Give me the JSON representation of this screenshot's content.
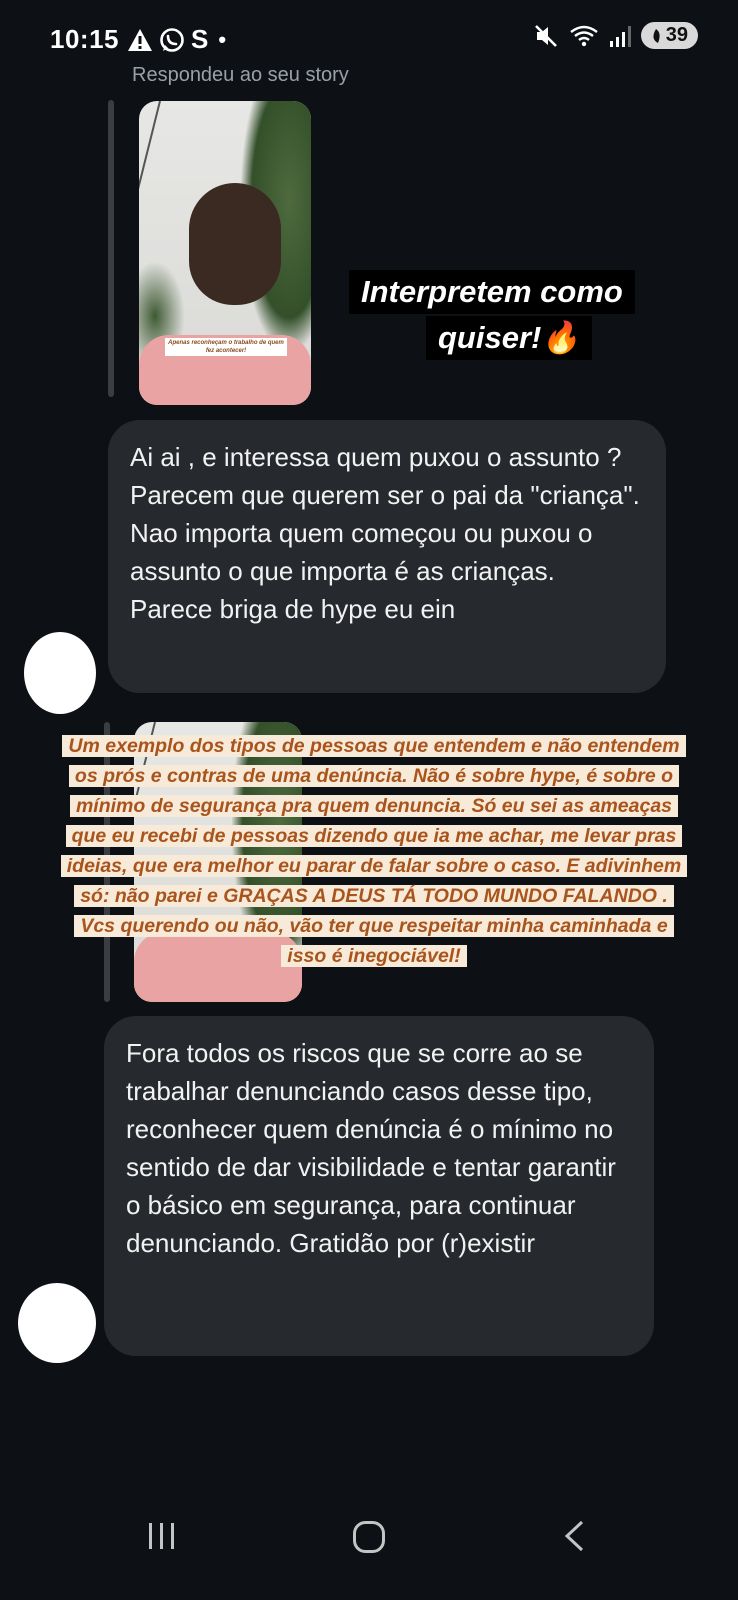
{
  "status_bar": {
    "time": "10:15",
    "left_icons": [
      "warning-icon",
      "whatsapp-icon",
      "s-app-icon",
      "dot"
    ],
    "s_glyph": "S",
    "dot_glyph": "•",
    "right_icons": [
      "mute-icon",
      "wifi-icon",
      "signal-icon"
    ],
    "battery_level": "39"
  },
  "conversation": {
    "reply_label": "Respondeu ao seu story",
    "story1": {
      "sticker_line1": "Interpretem como",
      "sticker_line2": "quiser!🔥",
      "thumb_caption": "Apenas reconheçam o trabalho de quem fez acontecer!"
    },
    "message1": "Ai ai , e interessa quem puxou o assunto ? Parecem que querem ser o pai da \"criança\". Nao importa quem começou ou puxou o assunto o que importa é as crianças. Parece briga de hype eu ein",
    "story2": {
      "overlay_text": "Um exemplo dos tipos de pessoas que entendem e não entendem os prós e contras de uma denúncia. Não é sobre hype, é sobre o mínimo de segurança pra quem denuncia. Só eu sei as ameaças que eu recebi de pessoas dizendo que ia me achar, me levar pras ideias, que era melhor eu parar de falar sobre o caso. E adivinhem só: não parei e GRAÇAS A DEUS TÁ TODO MUNDO FALANDO . Vcs querendo ou não, vão ter que respeitar minha caminhada e isso é inegociável!"
    },
    "message2": "Fora todos os riscos que se corre ao se trabalhar denunciando casos desse tipo, reconhecer quem denúncia é o mínimo no sentido de dar visibilidade e tentar garantir o básico em segurança, para continuar denunciando. Gratidão por (r)existir"
  },
  "nav_bar": {
    "buttons": [
      "recents-button",
      "home-button",
      "back-button"
    ]
  },
  "colors": {
    "background": "#0d1014",
    "bubble": "#26292e",
    "overlay_text": "#a9541c",
    "overlay_bg": "#f7ead8"
  }
}
